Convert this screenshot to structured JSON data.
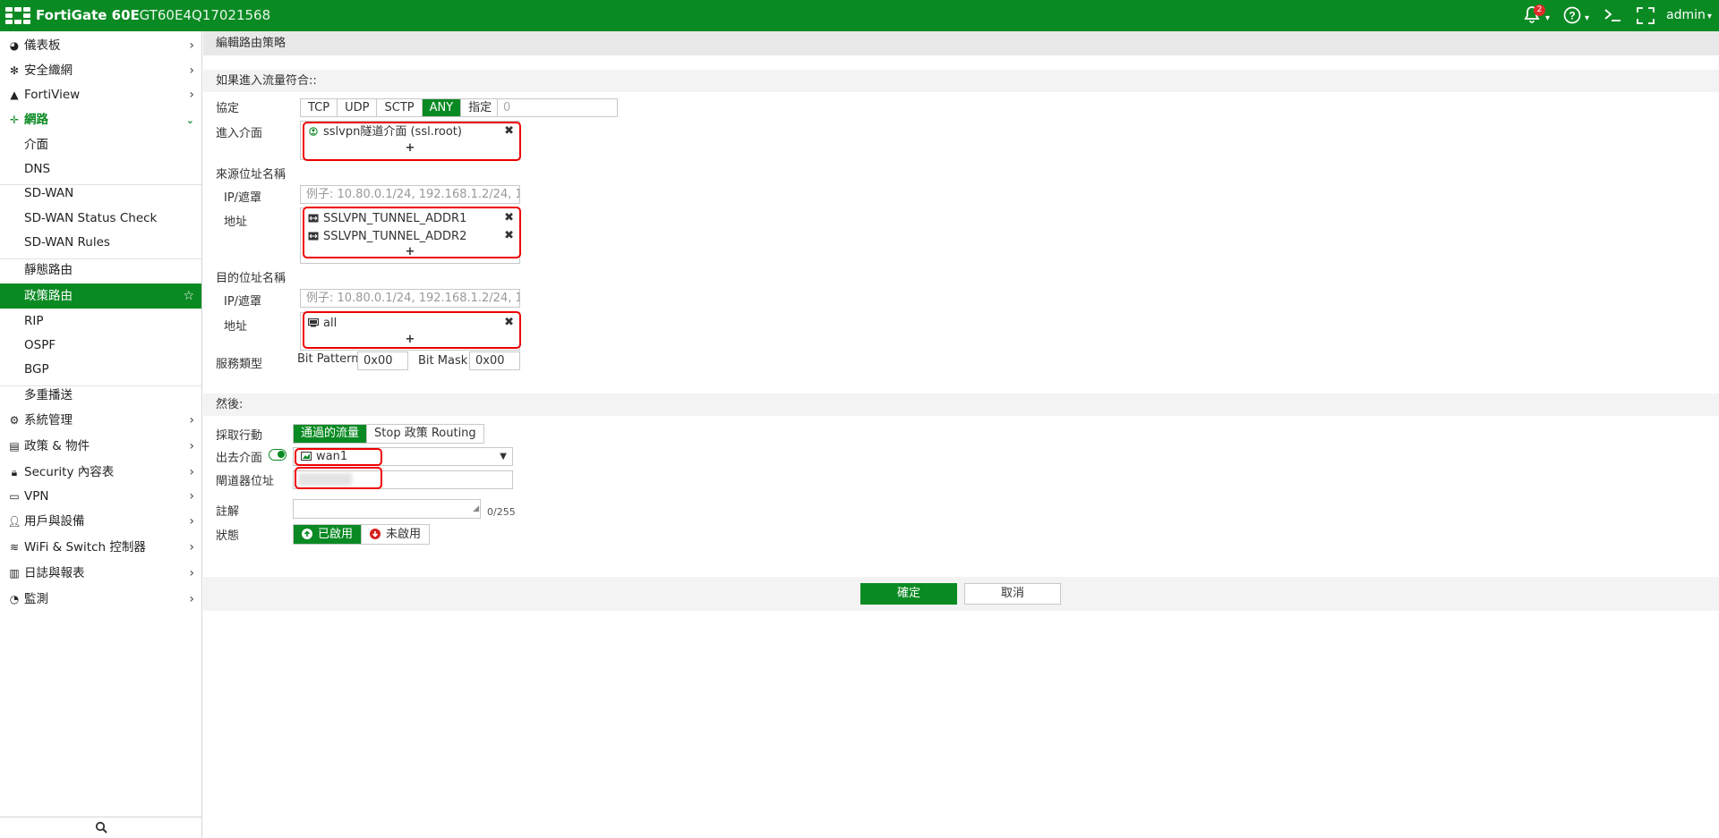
{
  "topbar": {
    "brand": "FortiGate 60E",
    "serial": "FGT60E4Q17021568",
    "notification_count": "2",
    "user": "admin",
    "user_caret": "▾",
    "help_icon": "?",
    "cli_icon": ">_",
    "fullscreen_icon": "⛶"
  },
  "sidebar": {
    "items": [
      {
        "label": "儀表板",
        "icon": "dashboard-icon"
      },
      {
        "label": "安全織網",
        "icon": "security-fabric-icon"
      },
      {
        "label": "FortiView",
        "icon": "fortiview-icon"
      },
      {
        "label": "網路",
        "icon": "network-icon"
      },
      {
        "label": "介面"
      },
      {
        "label": "DNS"
      },
      {
        "label": "SD-WAN"
      },
      {
        "label": "SD-WAN Status Check"
      },
      {
        "label": "SD-WAN Rules"
      },
      {
        "label": "靜態路由"
      },
      {
        "label": "政策路由"
      },
      {
        "label": "RIP"
      },
      {
        "label": "OSPF"
      },
      {
        "label": "BGP"
      },
      {
        "label": "多重播送"
      },
      {
        "label": "系統管理",
        "icon": "gear-icon"
      },
      {
        "label": "政策 & 物件",
        "icon": "policy-icon"
      },
      {
        "label": "Security 內容表",
        "icon": "lock-icon"
      },
      {
        "label": "VPN",
        "icon": "vpn-icon"
      },
      {
        "label": "用戶與設備",
        "icon": "user-icon"
      },
      {
        "label": "WiFi & Switch 控制器",
        "icon": "wifi-icon"
      },
      {
        "label": "日誌與報表",
        "icon": "log-icon"
      },
      {
        "label": "監測",
        "icon": "monitor-icon"
      }
    ]
  },
  "page": {
    "title": "編輯路由策略",
    "section1": "如果進入流量符合::",
    "protocol_label": "協定",
    "protocols": [
      "TCP",
      "UDP",
      "SCTP",
      "ANY",
      "指定"
    ],
    "protocol_selected": "ANY",
    "protocol_number": "0",
    "incoming_label": "進入介面",
    "incoming_entry": "sslvpn隧道介面 (ssl.root)",
    "source_label": "來源位址名稱",
    "ip_mask_label": "IP/遮罩",
    "ip_placeholder": "例子: 10.80.0.1/24, 192.168.1.2/24, 10.",
    "address_label": "地址",
    "source_addresses": [
      "SSLVPN_TUNNEL_ADDR1",
      "SSLVPN_TUNNEL_ADDR2"
    ],
    "dest_label": "目的位址名稱",
    "dest_addresses": [
      "all"
    ],
    "tos_label": "服務類型",
    "bit_pattern_label": "Bit Pattern",
    "bit_pattern_value": "0x00",
    "bit_mask_label": "Bit Mask",
    "bit_mask_value": "0x00",
    "plus": "+",
    "remove": "✖",
    "section2": "然後:",
    "action_label": "採取行動",
    "action_options": [
      "通過的流量",
      "Stop 政策 Routing"
    ],
    "outgoing_label": "出去介面",
    "outgoing_value": "wan1",
    "gateway_label": "閘道器位址",
    "gateway_value": "",
    "comment_label": "註解",
    "comment_counter": "0/255",
    "status_label": "狀態",
    "status_enabled": "已啟用",
    "status_disabled": "未啟用",
    "ok_button": "確定",
    "cancel_button": "取消"
  },
  "colors": {
    "brand_green": "#0a8a23",
    "highlight_red": "#e00000"
  }
}
